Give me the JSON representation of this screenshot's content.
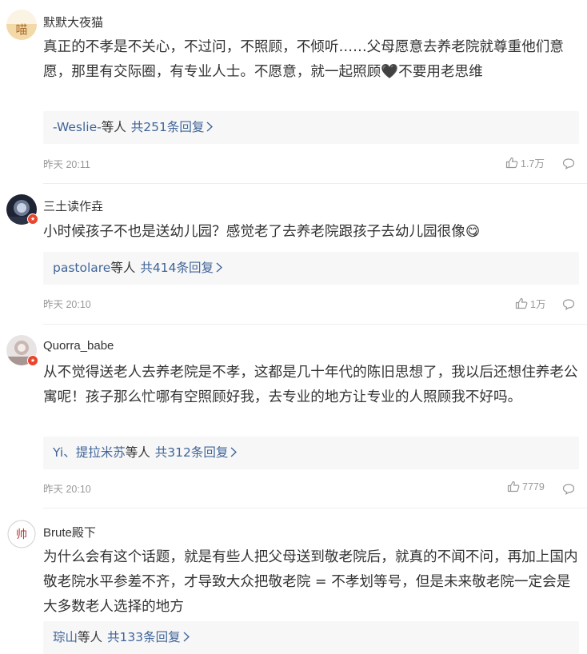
{
  "comments": [
    {
      "username": "默默大夜猫",
      "avatar_text": "喵",
      "text": "真正的不孝是不关心，不过问，不照顾，不倾听……父母愿意去养老院就尊重他们意愿，那里有交际圈，有专业人士。不愿意，就一起照顾🖤不要用老思维",
      "reply_users": "-Weslie-",
      "reply_mid": "等人",
      "reply_count": "共251条回复",
      "time": "昨天 20:11",
      "likes": "1.7万"
    },
    {
      "username": "三土读作垚",
      "text": "小时候孩子不也是送幼儿园？感觉老了去养老院跟孩子去幼儿园很像😋",
      "reply_users": "pastolare",
      "reply_mid": "等人",
      "reply_count": "共414条回复",
      "time": "昨天 20:10",
      "likes": "1万"
    },
    {
      "username": "Quorra_babe",
      "text": "从不觉得送老人去养老院是不孝，这都是几十年代的陈旧思想了，我以后还想住养老公寓呢！孩子那么忙哪有空照顾好我，去专业的地方让专业的人照顾我不好吗。",
      "reply_users": "Yi、提拉米苏",
      "reply_mid": "等人",
      "reply_count": "共312条回复",
      "time": "昨天 20:10",
      "likes": "7779"
    },
    {
      "username": "Brute殿下",
      "avatar_text": "帅",
      "text": "为什么会有这个话题，就是有些人把父母送到敬老院后，就真的不闻不问，再加上国内敬老院水平参差不齐，才导致大众把敬老院 = 不孝划等号，但是未来敬老院一定会是大多数老人选择的地方",
      "reply_users": "琮山",
      "reply_mid": "等人",
      "reply_count": "共133条回复"
    }
  ],
  "colors": {
    "link": "#406599",
    "text": "#333333",
    "meta": "#999999",
    "reply_bg": "#f7f7f7",
    "badge": "#e8452c"
  }
}
